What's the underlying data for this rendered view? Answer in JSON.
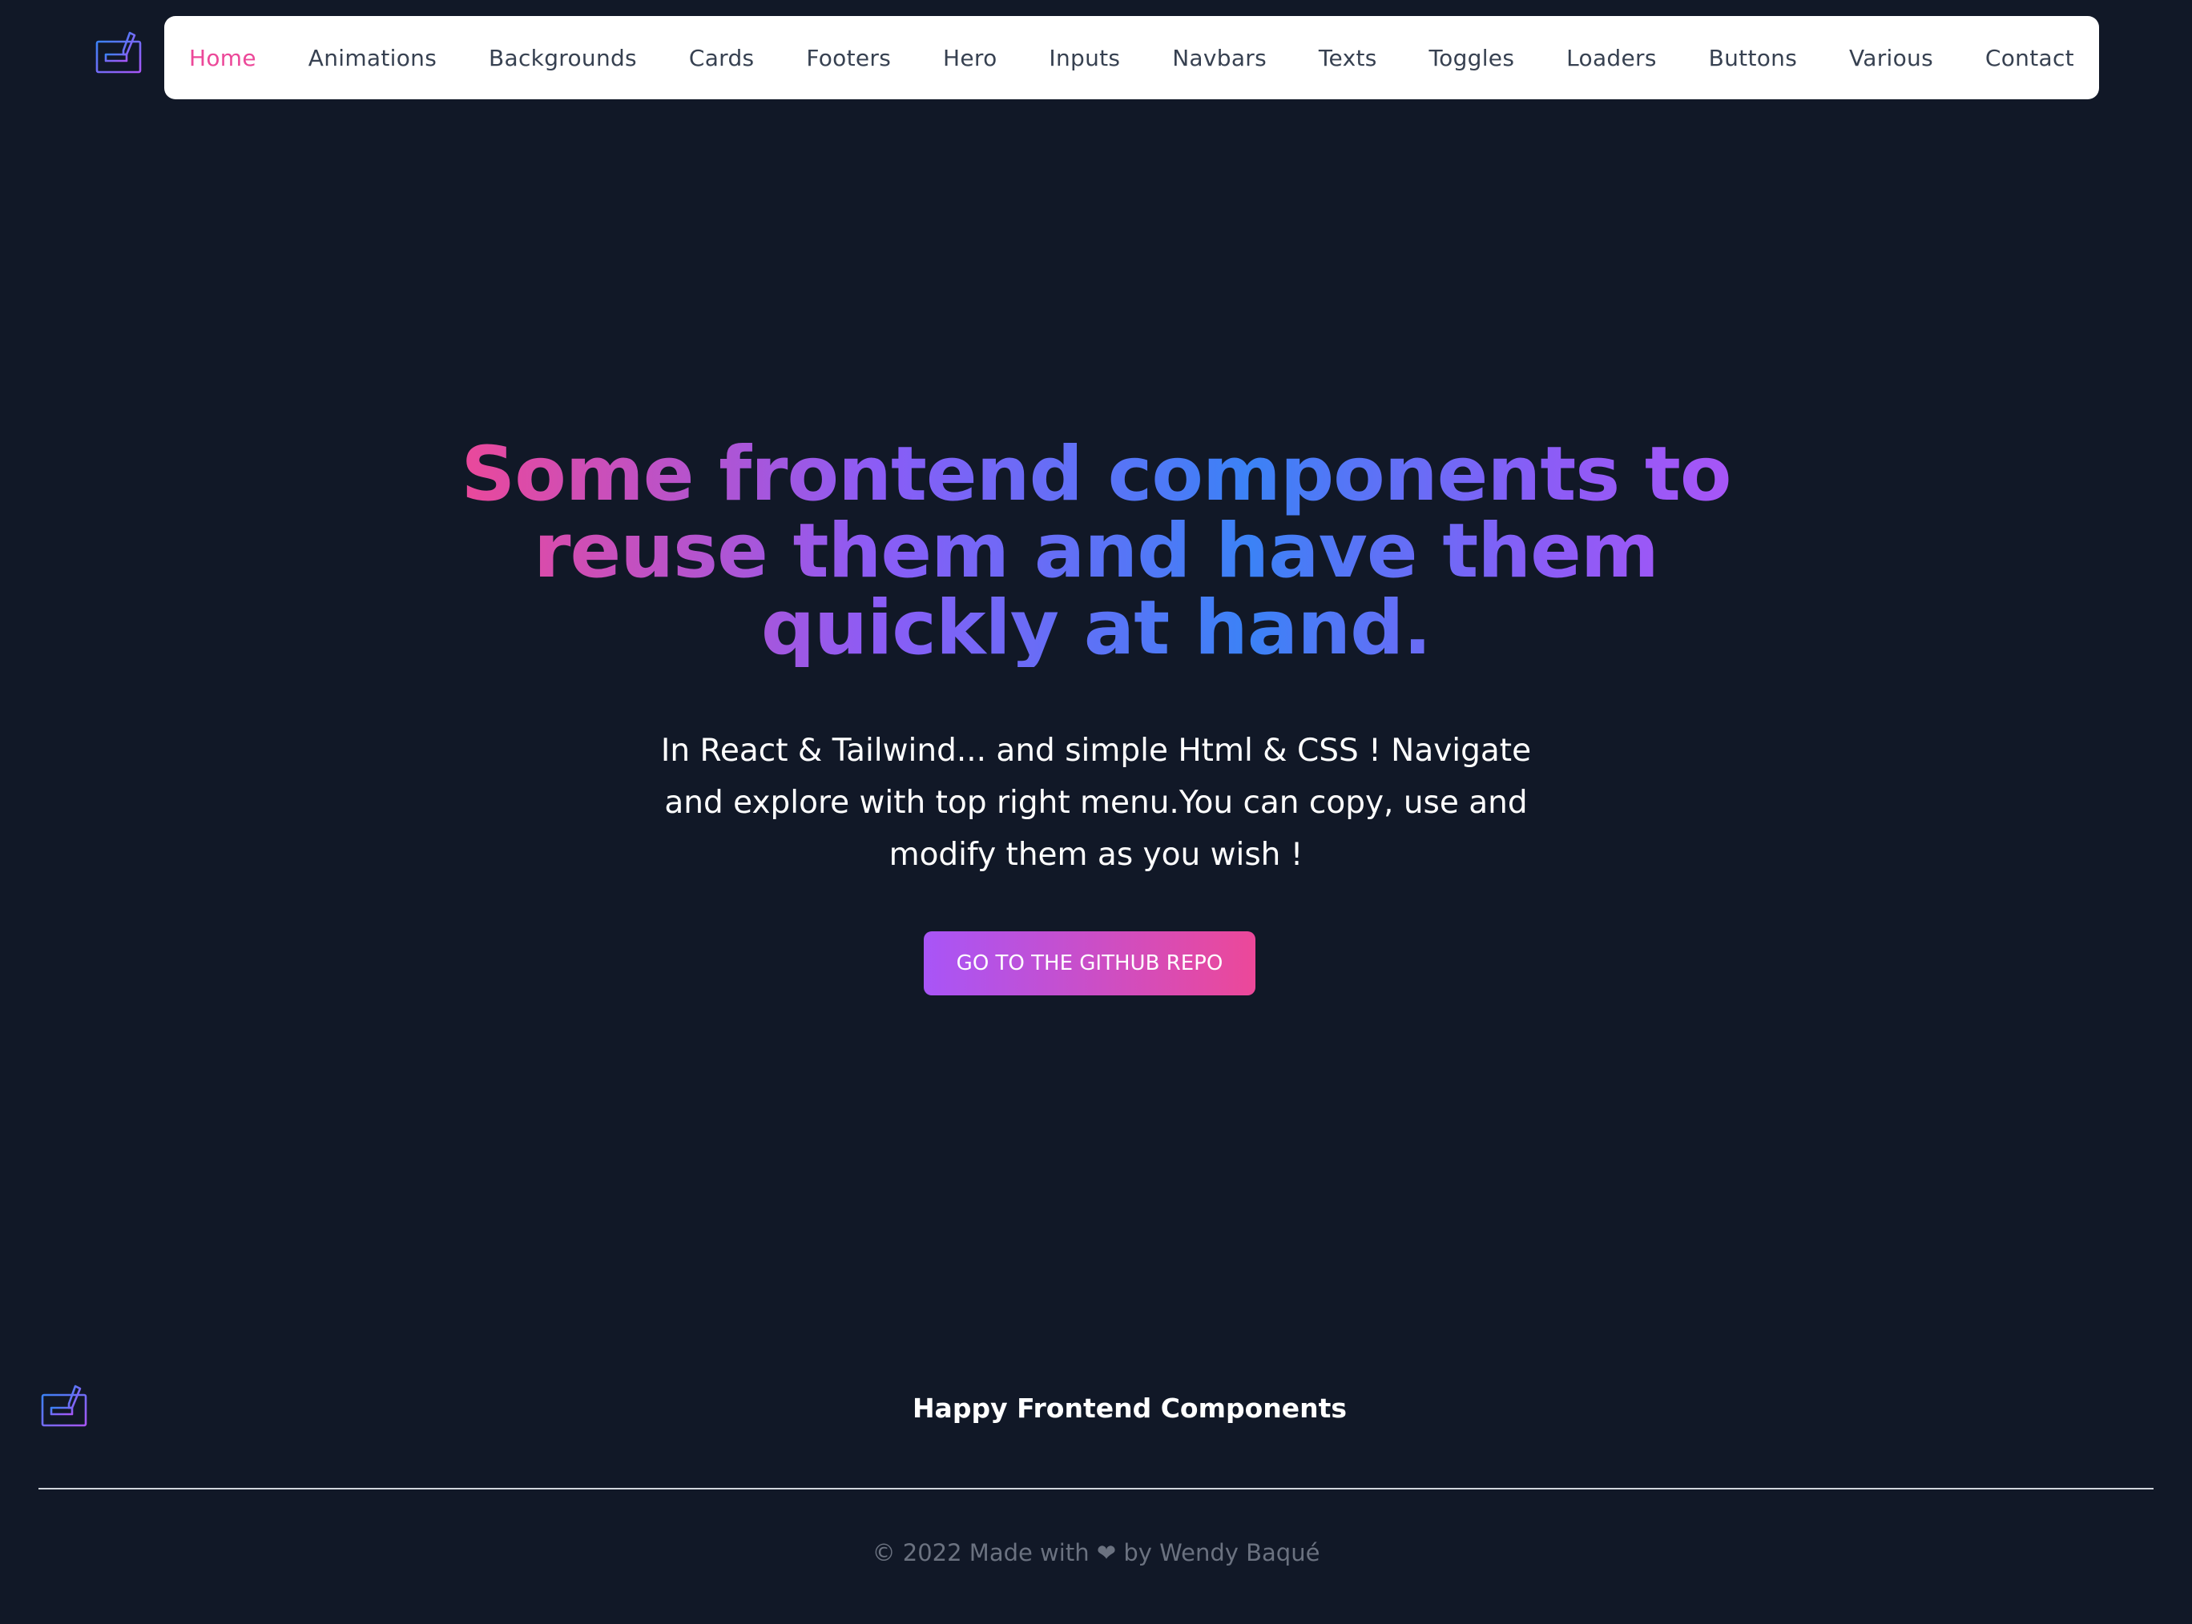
{
  "nav": {
    "items": [
      {
        "label": "Home",
        "active": true
      },
      {
        "label": "Animations"
      },
      {
        "label": "Backgrounds"
      },
      {
        "label": "Cards"
      },
      {
        "label": "Footers"
      },
      {
        "label": "Hero"
      },
      {
        "label": "Inputs"
      },
      {
        "label": "Navbars"
      },
      {
        "label": "Texts"
      },
      {
        "label": "Toggles"
      },
      {
        "label": "Loaders"
      },
      {
        "label": "Buttons"
      },
      {
        "label": "Various"
      },
      {
        "label": "Contact"
      }
    ]
  },
  "hero": {
    "title": "Some frontend components to reuse them and have them quickly at hand.",
    "subtitle": "In React & Tailwind... and simple Html & CSS ! Navigate and explore with top right menu.You can copy, use and modify them as you wish !",
    "cta_label": "GO TO THE GITHUB REPO"
  },
  "footer": {
    "title": "Happy Frontend Components",
    "copyright_prefix": "© 2022 Made with",
    "heart_glyph": "❤",
    "copyright_suffix": "by Wendy Baqué"
  },
  "icons": {
    "logo": "monitor-pencil-icon",
    "heart": "heart-icon"
  },
  "colors": {
    "background": "#111827",
    "nav_background": "#ffffff",
    "nav_text": "#374151",
    "accent_pink": "#ec4899",
    "accent_purple": "#a855f7",
    "accent_blue": "#3b82f6",
    "muted_text": "#6b7280"
  }
}
